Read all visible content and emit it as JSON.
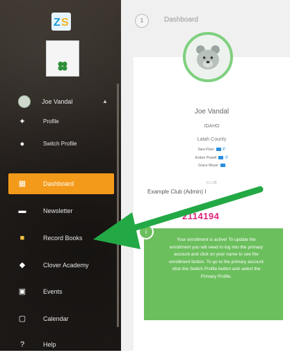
{
  "header": {
    "step_number": "1",
    "title": "Dashboard"
  },
  "sidebar": {
    "user": {
      "name": "Joe Vandal"
    },
    "profile_items": [
      {
        "label": "Profile",
        "icon": "person-icon"
      },
      {
        "label": "Switch Profile",
        "icon": "switch-user-icon"
      }
    ],
    "menu_items": [
      {
        "label": "Dashboard",
        "icon": "dashboard-icon",
        "active": true
      },
      {
        "label": "Newsletter",
        "icon": "newsletter-icon"
      },
      {
        "label": "Record Books",
        "icon": "record-books-icon"
      },
      {
        "label": "Clover Academy",
        "icon": "graduation-cap-icon"
      },
      {
        "label": "Events",
        "icon": "calendar-check-icon"
      },
      {
        "label": "Calendar",
        "icon": "calendar-icon"
      },
      {
        "label": "Help",
        "icon": "help-icon"
      }
    ]
  },
  "profile": {
    "name": "Joe Vandal",
    "state": "IDAHO",
    "county": "Latah County",
    "contacts": [
      {
        "name": "Sara Fluer",
        "email": true,
        "phone": true
      },
      {
        "name": "Ember Powell",
        "email": true,
        "phone": true
      },
      {
        "name": "Grace Meyer",
        "email": true,
        "phone": false
      }
    ],
    "club_label": "CLUB",
    "club_value": "Example Club (Admin) I",
    "member_id": "2114194"
  },
  "notice": {
    "text": "Your enrollment is active! To update the enrollment you will need to log into the primary account and click on your name to see the enrollment button. To go to the primary account click the Switch Profile button and select the Primary Profile."
  },
  "colors": {
    "accent_orange": "#f49a1a",
    "green": "#6cbf5d",
    "arrow_green": "#22a945",
    "member_id": "#e0227a"
  }
}
